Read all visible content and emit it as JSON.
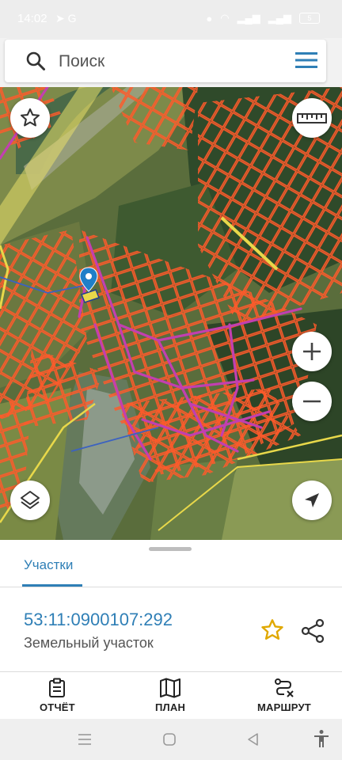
{
  "status_bar": {
    "time": "14:02",
    "battery": "5"
  },
  "search": {
    "placeholder": "Поиск"
  },
  "map": {
    "fabs": [
      "favorites-star",
      "ruler",
      "zoom-in",
      "zoom-out",
      "layers",
      "my-location"
    ]
  },
  "sheet": {
    "tab_label": "Участки",
    "parcel_id": "53:11:0900107:292",
    "parcel_type": "Земельный участок"
  },
  "bottom_nav": {
    "items": [
      {
        "label": "ОТЧЁТ",
        "icon": "report-icon"
      },
      {
        "label": "ПЛАН",
        "icon": "map-icon"
      },
      {
        "label": "МАРШРУТ",
        "icon": "route-icon"
      }
    ]
  },
  "colors": {
    "accent": "#2f7fb6",
    "parcel_border": "#ff5a2a",
    "road": "#c23fb0",
    "highlight": "#e8d84a",
    "marker": "#1f7fc8"
  }
}
